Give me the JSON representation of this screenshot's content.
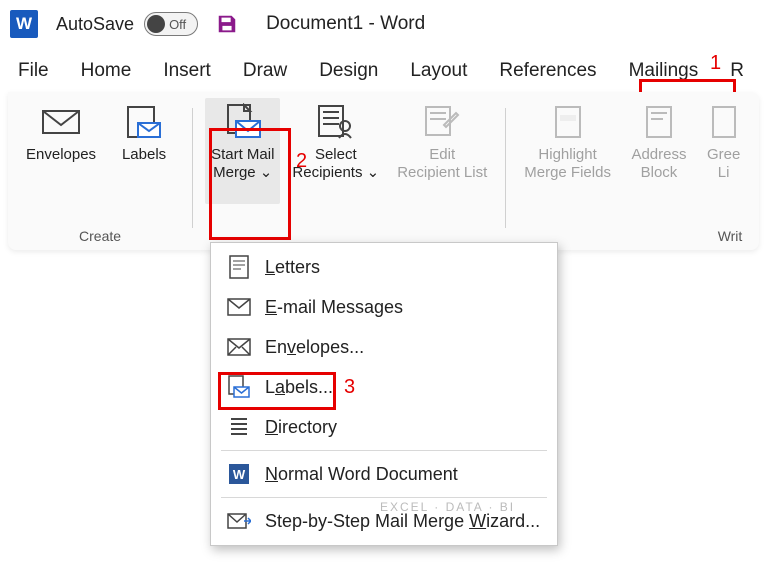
{
  "titlebar": {
    "autosave_label": "AutoSave",
    "toggle_state": "Off",
    "doc_title": "Document1  -  Word"
  },
  "tabs": {
    "file": "File",
    "home": "Home",
    "insert": "Insert",
    "draw": "Draw",
    "design": "Design",
    "layout": "Layout",
    "references": "References",
    "mailings": "Mailings",
    "review_initial": "R"
  },
  "ribbon": {
    "envelopes": "Envelopes",
    "labels": "Labels",
    "start_mail_merge": "Start Mail\nMerge ⌄",
    "select_recipients": "Select\nRecipients ⌄",
    "edit_recipient_list": "Edit\nRecipient List",
    "highlight_merge_fields": "Highlight\nMerge Fields",
    "address_block": "Address\nBlock",
    "greeting": "Gree\nLi",
    "group_create": "Create",
    "group_write": "Writ"
  },
  "menu": {
    "letters": "Letters",
    "email": "E-mail Messages",
    "envelopes": "Envelopes...",
    "labels": "Labels...",
    "directory": "Directory",
    "normal": "Normal Word Document",
    "wizard": "Step-by-Step Mail Merge Wizard..."
  },
  "annotations": {
    "n1": "1",
    "n2": "2",
    "n3": "3"
  },
  "watermark": "EXCEL · DATA · BI"
}
